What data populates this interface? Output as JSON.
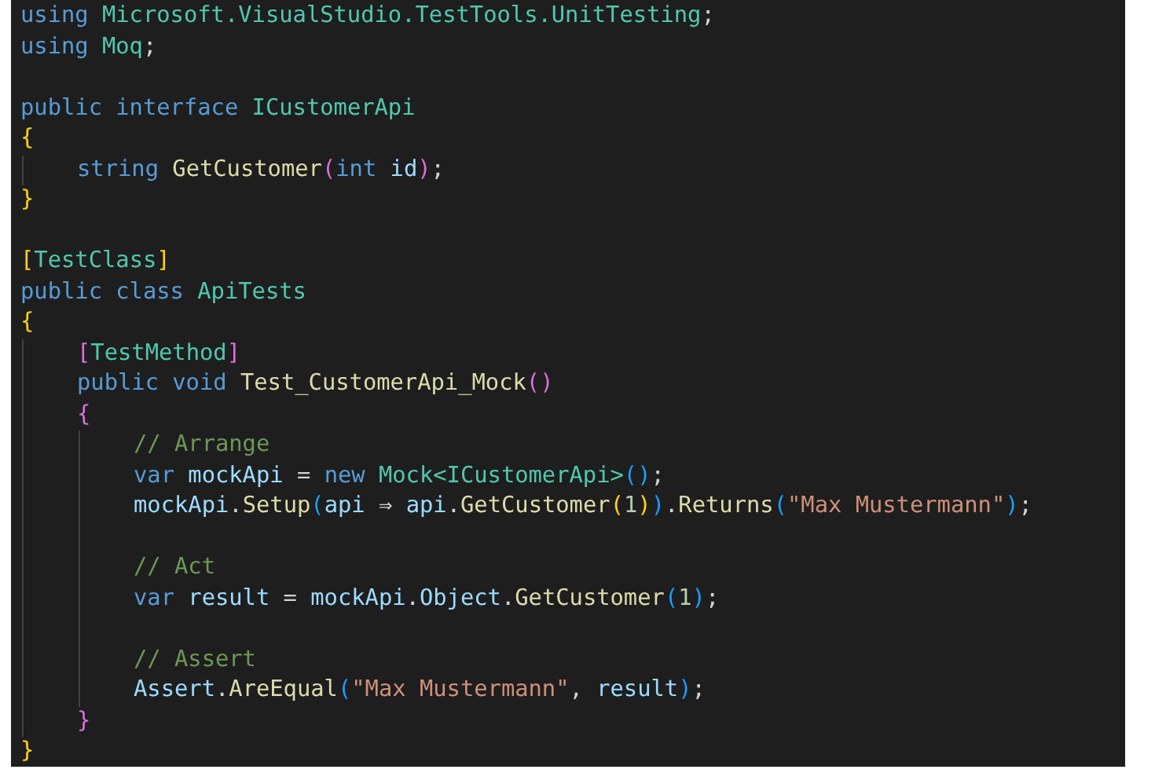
{
  "editor": {
    "lines": [
      {
        "kind": "code",
        "tokens": [
          {
            "text": "using ",
            "kind": "keyword"
          },
          {
            "text": "Microsoft.VisualStudio.TestTools.UnitTesting",
            "kind": "type"
          },
          {
            "text": ";",
            "kind": "punct"
          }
        ]
      },
      {
        "kind": "code",
        "tokens": [
          {
            "text": "using ",
            "kind": "keyword"
          },
          {
            "text": "Moq",
            "kind": "type"
          },
          {
            "text": ";",
            "kind": "punct"
          }
        ]
      },
      {
        "kind": "blank"
      },
      {
        "kind": "code",
        "tokens": [
          {
            "text": "public interface ",
            "kind": "keyword"
          },
          {
            "text": "ICustomerApi",
            "kind": "type"
          }
        ]
      },
      {
        "kind": "code",
        "tokens": [
          {
            "text": "{",
            "kind": "bracket1"
          }
        ],
        "children": [
          {
            "kind": "code",
            "tokens": [
              {
                "text": "string ",
                "kind": "keyword"
              },
              {
                "text": "GetCustomer",
                "kind": "method"
              },
              {
                "text": "(",
                "kind": "bracket2"
              },
              {
                "text": "int ",
                "kind": "keyword"
              },
              {
                "text": "id",
                "kind": "ident"
              },
              {
                "text": ")",
                "kind": "bracket2"
              },
              {
                "text": ";",
                "kind": "punct"
              }
            ]
          }
        ]
      },
      {
        "kind": "code",
        "tokens": [
          {
            "text": "}",
            "kind": "bracket1"
          }
        ]
      },
      {
        "kind": "blank"
      },
      {
        "kind": "code",
        "tokens": [
          {
            "text": "[",
            "kind": "bracket1"
          },
          {
            "text": "TestClass",
            "kind": "type"
          },
          {
            "text": "]",
            "kind": "bracket1"
          }
        ]
      },
      {
        "kind": "code",
        "tokens": [
          {
            "text": "public class ",
            "kind": "keyword"
          },
          {
            "text": "ApiTests",
            "kind": "type"
          }
        ]
      },
      {
        "kind": "code",
        "tokens": [
          {
            "text": "{",
            "kind": "bracket1"
          }
        ],
        "children": [
          {
            "kind": "code",
            "tokens": [
              {
                "text": "[",
                "kind": "bracket2"
              },
              {
                "text": "TestMethod",
                "kind": "type"
              },
              {
                "text": "]",
                "kind": "bracket2"
              }
            ]
          },
          {
            "kind": "code",
            "tokens": [
              {
                "text": "public void ",
                "kind": "keyword"
              },
              {
                "text": "Test_CustomerApi_Mock",
                "kind": "method"
              },
              {
                "text": "()",
                "kind": "bracket2"
              }
            ]
          },
          {
            "kind": "code",
            "tokens": [
              {
                "text": "{",
                "kind": "bracket2"
              }
            ],
            "children": [
              {
                "kind": "code",
                "tokens": [
                  {
                    "text": "// Arrange",
                    "kind": "comment"
                  }
                ]
              },
              {
                "kind": "code",
                "tokens": [
                  {
                    "text": "var ",
                    "kind": "keyword"
                  },
                  {
                    "text": "mockApi",
                    "kind": "ident"
                  },
                  {
                    "text": " = ",
                    "kind": "punct"
                  },
                  {
                    "text": "new ",
                    "kind": "keyword"
                  },
                  {
                    "text": "Mock<ICustomerApi>",
                    "kind": "type"
                  },
                  {
                    "text": "()",
                    "kind": "bracket3"
                  },
                  {
                    "text": ";",
                    "kind": "punct"
                  }
                ]
              },
              {
                "kind": "code",
                "tokens": [
                  {
                    "text": "mockApi",
                    "kind": "ident"
                  },
                  {
                    "text": ".",
                    "kind": "punct"
                  },
                  {
                    "text": "Setup",
                    "kind": "method"
                  },
                  {
                    "text": "(",
                    "kind": "bracket3"
                  },
                  {
                    "text": "api",
                    "kind": "ident"
                  },
                  {
                    "text": " ⇒ ",
                    "kind": "punct"
                  },
                  {
                    "text": "api",
                    "kind": "ident"
                  },
                  {
                    "text": ".",
                    "kind": "punct"
                  },
                  {
                    "text": "GetCustomer",
                    "kind": "method"
                  },
                  {
                    "text": "(",
                    "kind": "bracket1"
                  },
                  {
                    "text": "1",
                    "kind": "number"
                  },
                  {
                    "text": ")",
                    "kind": "bracket1"
                  },
                  {
                    "text": ")",
                    "kind": "bracket3"
                  },
                  {
                    "text": ".",
                    "kind": "punct"
                  },
                  {
                    "text": "Returns",
                    "kind": "method"
                  },
                  {
                    "text": "(",
                    "kind": "bracket3"
                  },
                  {
                    "text": "\"Max Mustermann\"",
                    "kind": "string"
                  },
                  {
                    "text": ")",
                    "kind": "bracket3"
                  },
                  {
                    "text": ";",
                    "kind": "punct"
                  }
                ]
              },
              {
                "kind": "blank"
              },
              {
                "kind": "code",
                "tokens": [
                  {
                    "text": "// Act",
                    "kind": "comment"
                  }
                ]
              },
              {
                "kind": "code",
                "tokens": [
                  {
                    "text": "var ",
                    "kind": "keyword"
                  },
                  {
                    "text": "result",
                    "kind": "ident"
                  },
                  {
                    "text": " = ",
                    "kind": "punct"
                  },
                  {
                    "text": "mockApi",
                    "kind": "ident"
                  },
                  {
                    "text": ".",
                    "kind": "punct"
                  },
                  {
                    "text": "Object",
                    "kind": "ident"
                  },
                  {
                    "text": ".",
                    "kind": "punct"
                  },
                  {
                    "text": "GetCustomer",
                    "kind": "method"
                  },
                  {
                    "text": "(",
                    "kind": "bracket3"
                  },
                  {
                    "text": "1",
                    "kind": "number"
                  },
                  {
                    "text": ")",
                    "kind": "bracket3"
                  },
                  {
                    "text": ";",
                    "kind": "punct"
                  }
                ]
              },
              {
                "kind": "blank"
              },
              {
                "kind": "code",
                "tokens": [
                  {
                    "text": "// Assert",
                    "kind": "comment"
                  }
                ]
              },
              {
                "kind": "code",
                "tokens": [
                  {
                    "text": "Assert",
                    "kind": "ident"
                  },
                  {
                    "text": ".",
                    "kind": "punct"
                  },
                  {
                    "text": "AreEqual",
                    "kind": "method"
                  },
                  {
                    "text": "(",
                    "kind": "bracket3"
                  },
                  {
                    "text": "\"Max Mustermann\"",
                    "kind": "string"
                  },
                  {
                    "text": ", ",
                    "kind": "punct"
                  },
                  {
                    "text": "result",
                    "kind": "ident"
                  },
                  {
                    "text": ")",
                    "kind": "bracket3"
                  },
                  {
                    "text": ";",
                    "kind": "punct"
                  }
                ]
              }
            ]
          },
          {
            "kind": "code",
            "tokens": [
              {
                "text": "}",
                "kind": "bracket2"
              }
            ]
          }
        ]
      },
      {
        "kind": "code",
        "tokens": [
          {
            "text": "}",
            "kind": "bracket1"
          }
        ]
      }
    ]
  }
}
